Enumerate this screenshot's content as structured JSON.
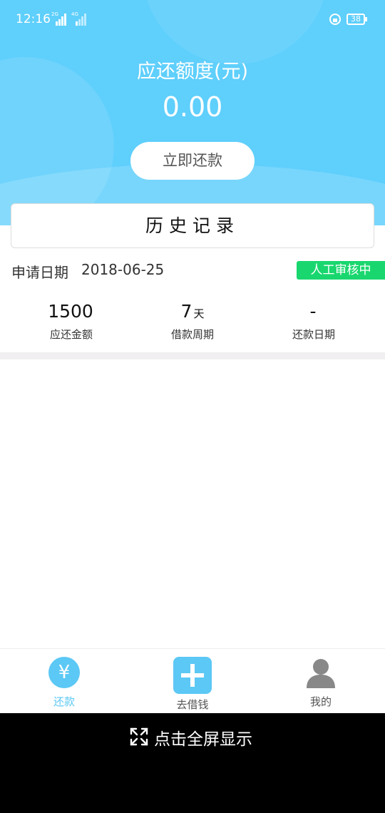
{
  "status_bar": {
    "time": "12:16",
    "sim1_tag": "2G",
    "sim2_tag": "4G",
    "battery": "38"
  },
  "header": {
    "label": "应还额度(元)",
    "amount": "0.00",
    "repay_button": "立即还款"
  },
  "history": {
    "title": "历史记录",
    "apply_label": "申请日期",
    "apply_date": "2018-06-25",
    "status": "人工审核中",
    "stats": [
      {
        "value": "1500",
        "unit": "",
        "label": "应还金额"
      },
      {
        "value": "7",
        "unit": "天",
        "label": "借款周期"
      },
      {
        "value": "-",
        "unit": "",
        "label": "还款日期"
      }
    ]
  },
  "tabs": [
    {
      "label": "还款",
      "icon": "yen-icon",
      "active": true
    },
    {
      "label": "去借钱",
      "icon": "plus-icon",
      "active": false
    },
    {
      "label": "我的",
      "icon": "person-icon",
      "active": false
    }
  ],
  "fullscreen": {
    "label": "点击全屏显示"
  },
  "colors": {
    "brand": "#5fcffc",
    "tab_active": "#5cc8f5",
    "status_badge": "#19d76e",
    "tab_inactive": "#666666"
  }
}
